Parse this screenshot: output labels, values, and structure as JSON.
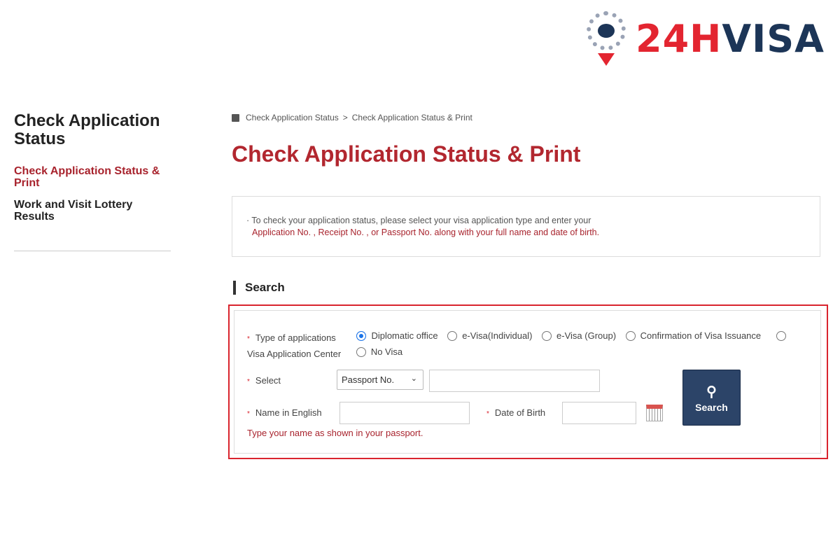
{
  "logo": {
    "text_red": "24H",
    "text_blue": "VISA"
  },
  "sidebar": {
    "title": "Check Application Status",
    "items": [
      {
        "label": "Check Application Status & Print",
        "active": true
      },
      {
        "label": "Work and Visit Lottery Results",
        "active": false
      }
    ]
  },
  "breadcrumb": {
    "home_icon": "home-icon",
    "items": [
      "Check Application Status",
      "Check Application Status & Print"
    ],
    "separator": ">"
  },
  "page_title": "Check Application Status & Print",
  "notice": {
    "line1": "· To check your application status, please select your visa application type and enter your",
    "line2": "Application No. , Receipt No. , or Passport No. along with your full name and date of birth."
  },
  "section_title": "Search",
  "form": {
    "type_label": "Type of applications",
    "types": [
      {
        "label": "Diplomatic office",
        "checked": true
      },
      {
        "label": "e-Visa(Individual)",
        "checked": false
      },
      {
        "label": "e-Visa (Group)",
        "checked": false
      },
      {
        "label": "Confirmation of Visa Issuance",
        "checked": false
      },
      {
        "label": "Visa Application Center",
        "checked": false
      },
      {
        "label": "No Visa",
        "checked": false
      }
    ],
    "select_label": "Select",
    "select_value": "Passport No.",
    "select_input": "",
    "name_label": "Name in English",
    "name_value": "",
    "dob_label": "Date of Birth",
    "dob_value": "",
    "search_button": "Search",
    "hint": "Type your name as shown in your passport.",
    "required_mark": "*"
  },
  "colors": {
    "accent": "#b2272f",
    "button": "#2c4468",
    "highlight": "#d9242e"
  }
}
